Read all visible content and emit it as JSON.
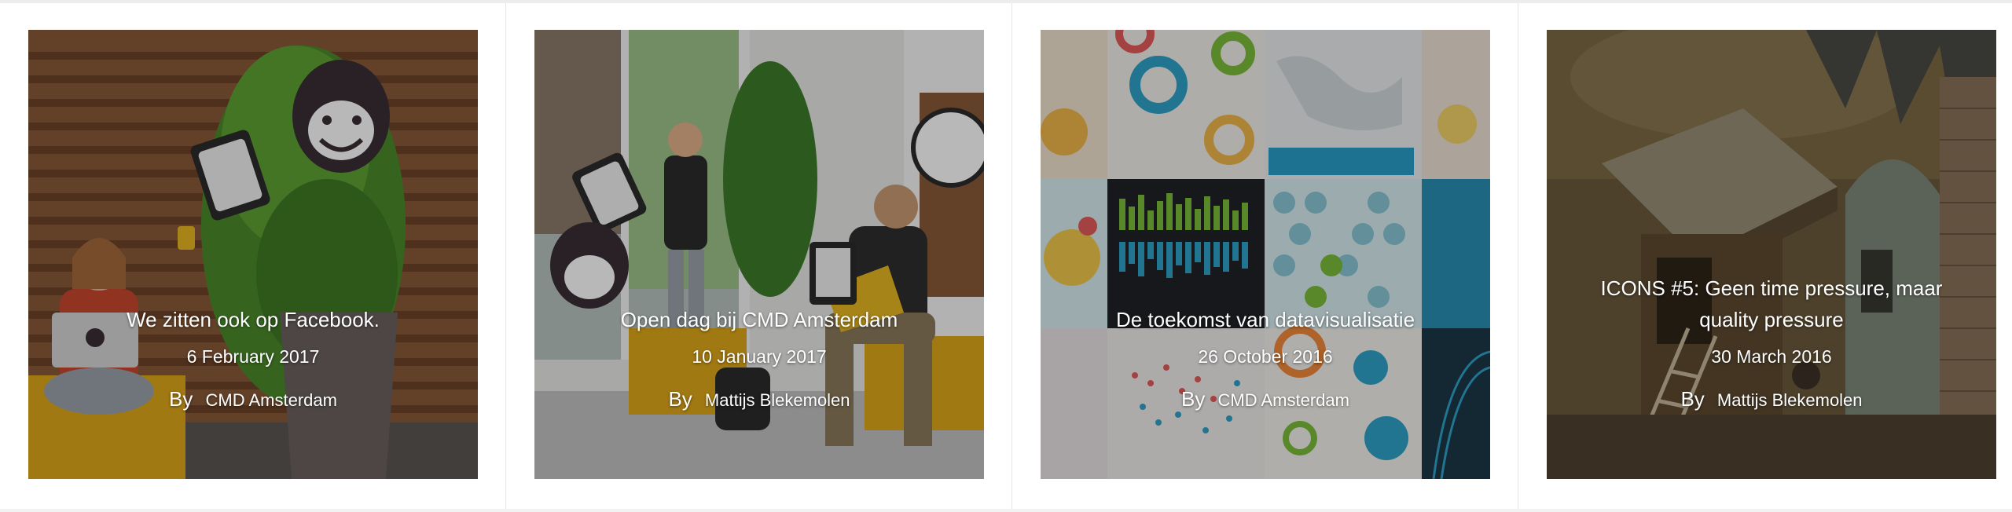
{
  "posts": [
    {
      "title": "We zitten ook op Facebook.",
      "date": "6 February 2017",
      "by": "By",
      "author": "CMD Amsterdam",
      "image": "people-with-cartoon-cutouts-wood-wall-icon"
    },
    {
      "title": "Open dag bij CMD Amsterdam",
      "date": "10 January 2017",
      "by": "By",
      "author": "Mattijs Blekemolen",
      "image": "students-in-lobby-icon"
    },
    {
      "title": "De toekomst van datavisualisatie",
      "date": "26 October 2016",
      "by": "By",
      "author": "CMD Amsterdam",
      "image": "data-visualisation-collage-icon"
    },
    {
      "title": "ICONS #5: Geen time pressure, maar quality pressure",
      "date": "30 March 2016",
      "by": "By",
      "author": "Mattijs Blekemolen",
      "image": "medieval-painting-detail-icon"
    }
  ],
  "colors": {
    "divider": "#e6e6e6",
    "text": "#ffffff",
    "background": "#ffffff"
  }
}
